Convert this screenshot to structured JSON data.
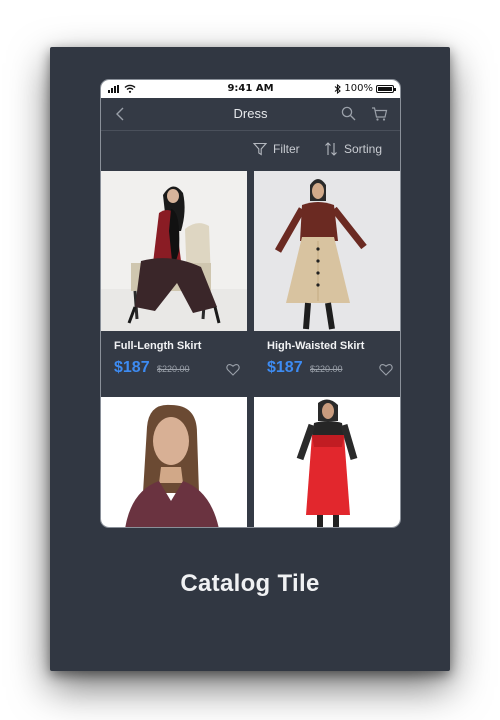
{
  "status_bar": {
    "time": "9:41 AM",
    "battery": "100%",
    "icons": [
      "signal-icon",
      "wifi-icon",
      "bluetooth-icon",
      "battery-icon"
    ]
  },
  "nav": {
    "title": "Dress",
    "icons": [
      "back-icon",
      "search-icon",
      "cart-icon"
    ]
  },
  "toolbar": {
    "filter_label": "Filter",
    "sorting_label": "Sorting",
    "icons": [
      "filter-icon",
      "sort-icon"
    ]
  },
  "products": [
    {
      "name": "Full-Length Skirt",
      "price": "$187",
      "old_price": "$220.00"
    },
    {
      "name": "High-Waisted Skirt",
      "price": "$187",
      "old_price": "$220.00"
    },
    {
      "name": "",
      "price": "",
      "old_price": ""
    },
    {
      "name": "",
      "price": "",
      "old_price": ""
    }
  ],
  "caption": "Catalog Tile",
  "colors": {
    "background": "#313742",
    "accent_price": "#3d8bf2",
    "text": "#f2f3f5"
  }
}
